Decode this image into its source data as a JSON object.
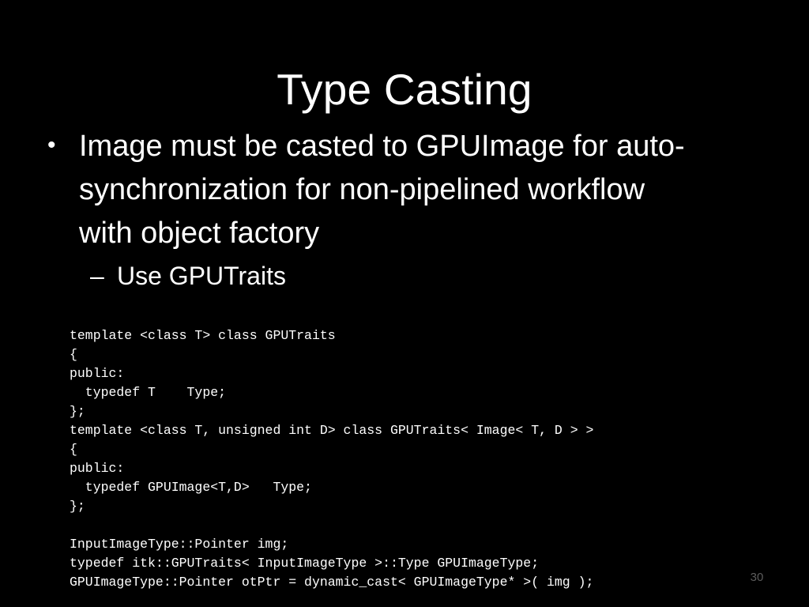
{
  "slide": {
    "title": "Type Casting",
    "page_number": "30",
    "background_color": "#000000",
    "text_color": "#ffffff",
    "page_number_color": "#5c5c5c"
  },
  "bullets": {
    "level1": {
      "marker": "•",
      "text": "Image must be casted to GPUImage for auto-synchronization for non-pipelined workflow with object factory"
    },
    "level2": {
      "marker": "–",
      "text": "Use GPUTraits"
    }
  },
  "code": {
    "lines": [
      "template <class T> class GPUTraits",
      "{",
      "public:",
      "  typedef T    Type;",
      "};",
      "template <class T, unsigned int D> class GPUTraits< Image< T, D > >",
      "{",
      "public:",
      "  typedef GPUImage<T,D>   Type;",
      "};",
      "",
      "InputImageType::Pointer img;",
      "typedef itk::GPUTraits< InputImageType >::Type GPUImageType;",
      "GPUImageType::Pointer otPtr = dynamic_cast< GPUImageType* >( img );"
    ]
  }
}
